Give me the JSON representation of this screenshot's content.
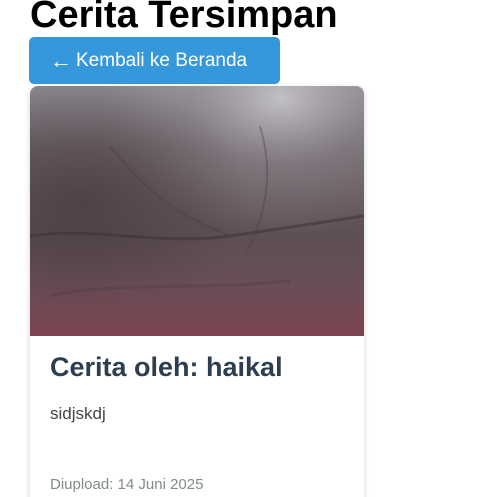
{
  "page": {
    "title": "Cerita Tersimpan"
  },
  "nav": {
    "back_arrow": "←",
    "back_label": "Kembali ke Beranda"
  },
  "stories": [
    {
      "title": "Cerita oleh: haikal",
      "text": "sidjskdj",
      "date": "Diupload: 14 Juni 2025"
    }
  ],
  "colors": {
    "button_bg": "#3498db",
    "title_text": "#2c3e50",
    "date_text": "#7f8c8d"
  }
}
